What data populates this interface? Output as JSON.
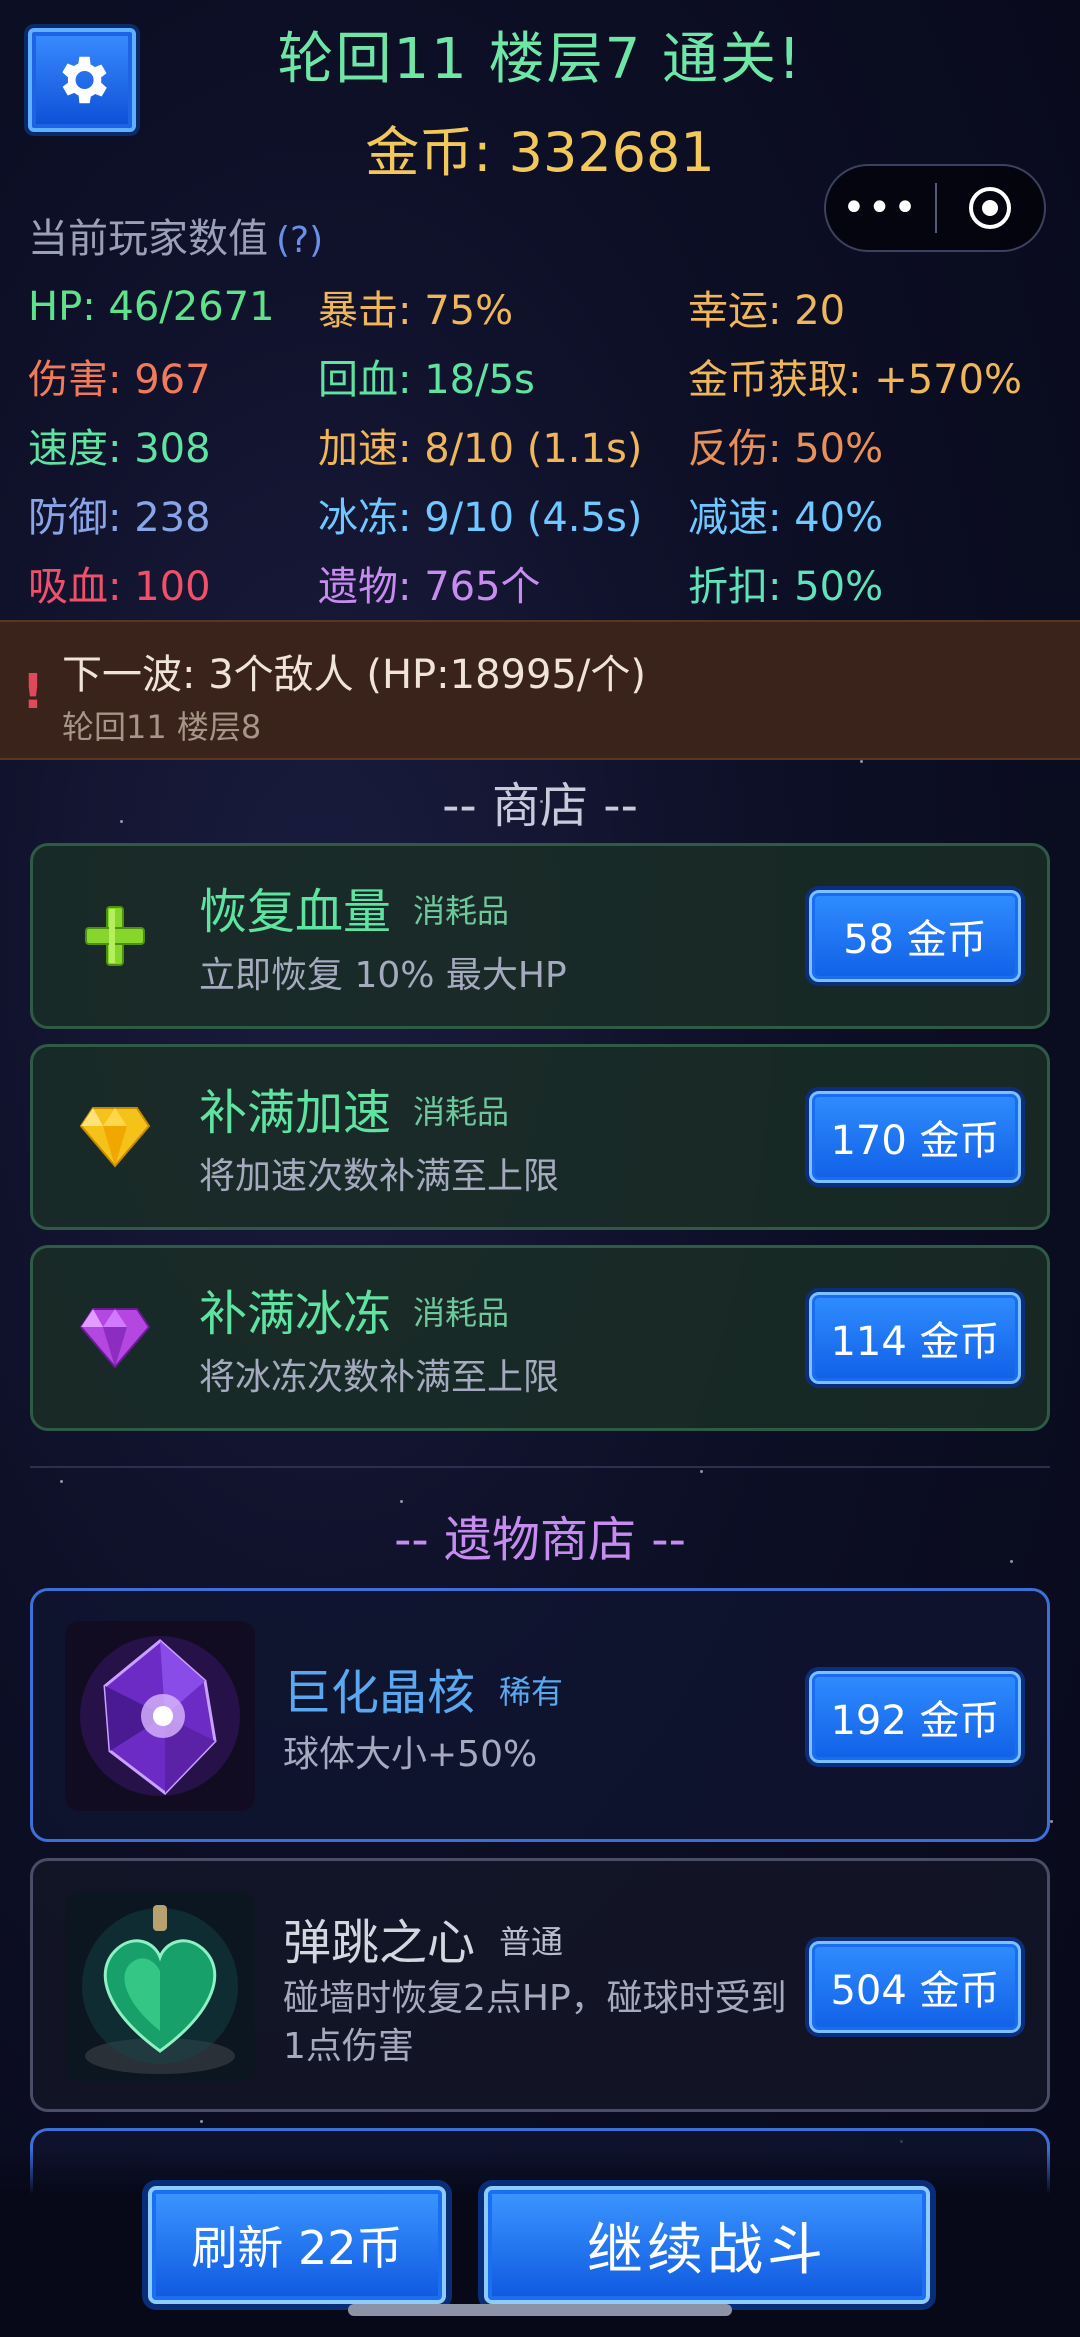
{
  "header": {
    "title": "轮回11 楼层7 通关!",
    "gold_label": "金币: 332681",
    "settings_icon": "gear-icon",
    "menu_icon": "more-dots-icon",
    "close_icon": "target-circle-icon"
  },
  "stats": {
    "title": "当前玩家数值",
    "help": "(?)",
    "rows": [
      [
        {
          "text": "HP: 46/2671",
          "color": "#5fe38a"
        },
        {
          "text": "暴击: 75%",
          "color": "#f0b65a"
        },
        {
          "text": "幸运: 20",
          "color": "#f0b65a"
        }
      ],
      [
        {
          "text": "伤害: 967",
          "color": "#f07a5a"
        },
        {
          "text": "回血: 18/5s",
          "color": "#5fe3a0"
        },
        {
          "text": "金币获取: +570%",
          "color": "#f0b65a"
        }
      ],
      [
        {
          "text": "速度: 308",
          "color": "#5fe3a0"
        },
        {
          "text": "加速: 8/10 (1.1s)",
          "color": "#f0b65a"
        },
        {
          "text": "反伤: 50%",
          "color": "#e89058"
        }
      ],
      [
        {
          "text": "防御: 238",
          "color": "#8aa4e8"
        },
        {
          "text": "冰冻: 9/10 (4.5s)",
          "color": "#6fc8ff"
        },
        {
          "text": "减速: 40%",
          "color": "#6fc8ff"
        }
      ],
      [
        {
          "text": "吸血: 100",
          "color": "#f0506a"
        },
        {
          "text": "遗物: 765个",
          "color": "#c88cf0"
        },
        {
          "text": "折扣: 50%",
          "color": "#5fe3b8"
        }
      ]
    ]
  },
  "next_wave": {
    "alert_icon": "!",
    "text": "下一波: 3个敌人 (HP:18995/个)",
    "sub": "轮回11 楼层8"
  },
  "shop": {
    "title": "-- 商店 --",
    "items": [
      {
        "name": "恢复血量",
        "tag": "消耗品",
        "desc": "立即恢复 10% 最大HP",
        "price": "58 金币",
        "icon": "green-plus-icon"
      },
      {
        "name": "补满加速",
        "tag": "消耗品",
        "desc": "将加速次数补满至上限",
        "price": "170 金币",
        "icon": "yellow-gem-icon"
      },
      {
        "name": "补满冰冻",
        "tag": "消耗品",
        "desc": "将冰冻次数补满至上限",
        "price": "114 金币",
        "icon": "purple-gem-icon"
      }
    ]
  },
  "relic_shop": {
    "title": "-- 遗物商店 --",
    "items": [
      {
        "name": "巨化晶核",
        "tag": "稀有",
        "desc": "球体大小+50%",
        "price": "192 金币",
        "icon": "purple-crystal-core-image"
      },
      {
        "name": "弹跳之心",
        "tag": "普通",
        "desc": "碰墙时恢复2点HP，碰球时受到1点伤害",
        "price": "504 金币",
        "icon": "green-heart-pendant-image"
      }
    ]
  },
  "footer": {
    "refresh_label": "刷新 22币",
    "continue_label": "继续战斗"
  }
}
